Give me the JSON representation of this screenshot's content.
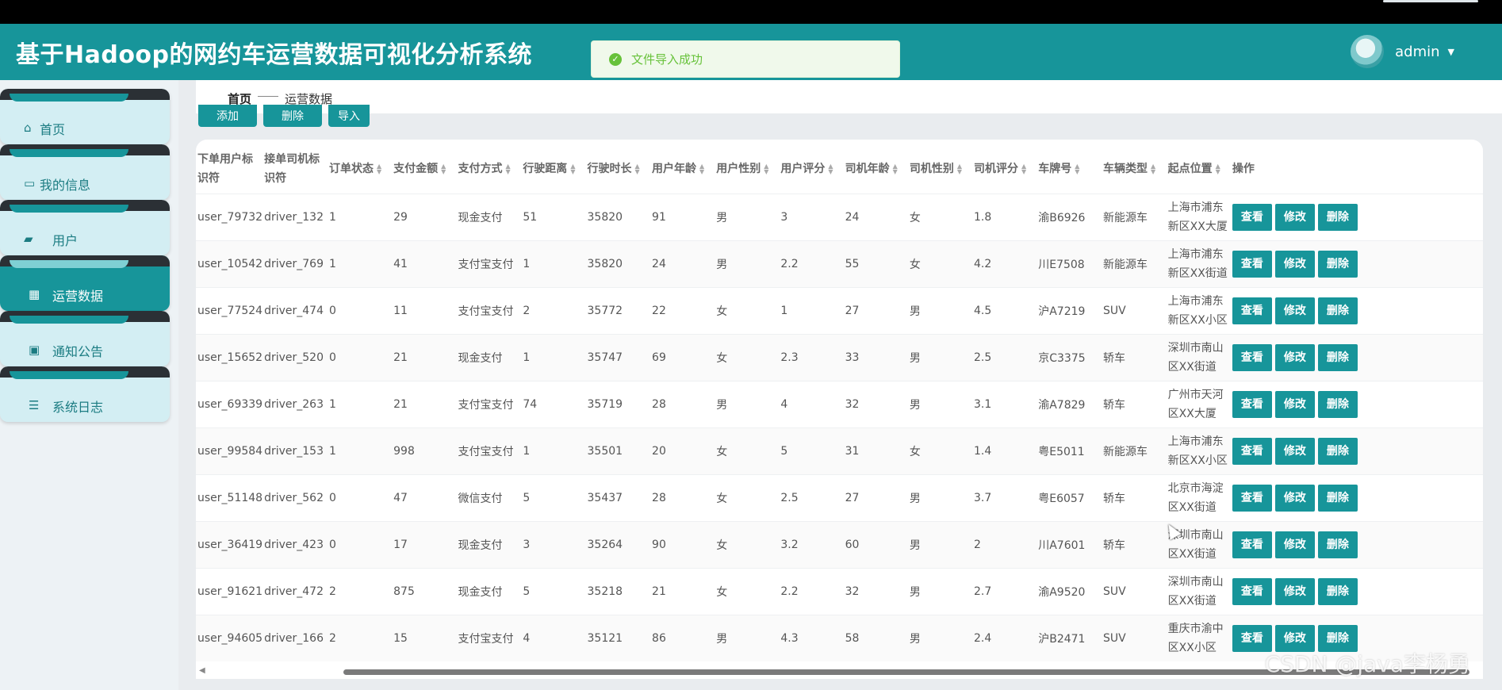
{
  "app": {
    "title": "基于Hadoop的网约车运营数据可视化分析系统"
  },
  "toast": {
    "message": "文件导入成功",
    "icon": "check-circle-icon",
    "color": "#67c23a"
  },
  "user": {
    "name": "admin"
  },
  "colors": {
    "brand": "#17959a",
    "header": "#17959a"
  },
  "sidebar": {
    "items": [
      {
        "label": "首页",
        "icon": "home-icon",
        "glyph": "⌂",
        "active": false
      },
      {
        "label": "我的信息",
        "icon": "id-card-icon",
        "glyph": "▭",
        "active": false
      },
      {
        "label": "用户",
        "icon": "chat-icon",
        "glyph": "▰",
        "active": false
      },
      {
        "label": "运营数据",
        "icon": "grid-icon",
        "glyph": "▦",
        "active": true
      },
      {
        "label": "通知公告",
        "icon": "clipboard-icon",
        "glyph": "▣",
        "active": false
      },
      {
        "label": "系统日志",
        "icon": "list-icon",
        "glyph": "☰",
        "active": false
      }
    ]
  },
  "breadcrumb": {
    "home": "首页",
    "current": "运营数据"
  },
  "toolbar": {
    "add_label": "添加",
    "delete_label": "删除",
    "import_label": "导入"
  },
  "table": {
    "columns": [
      "下单用户标识符",
      "接单司机标识符",
      "订单状态",
      "支付金额",
      "支付方式",
      "行驶距离",
      "行驶时长",
      "用户年龄",
      "用户性别",
      "用户评分",
      "司机年龄",
      "司机性别",
      "司机评分",
      "车牌号",
      "车辆类型",
      "起点位置",
      "操作"
    ],
    "rows": [
      [
        "user_79732",
        "driver_132",
        "1",
        "29",
        "现金支付",
        "51",
        "35820",
        "91",
        "男",
        "3",
        "24",
        "女",
        "1.8",
        "渝B6926",
        "新能源车",
        "上海市浦东新区XX大厦"
      ],
      [
        "user_10542",
        "driver_769",
        "1",
        "41",
        "支付宝支付",
        "1",
        "35820",
        "24",
        "男",
        "2.2",
        "55",
        "女",
        "4.2",
        "川E7508",
        "新能源车",
        "上海市浦东新区XX街道"
      ],
      [
        "user_77524",
        "driver_474",
        "0",
        "11",
        "支付宝支付",
        "2",
        "35772",
        "22",
        "女",
        "1",
        "27",
        "男",
        "4.5",
        "沪A7219",
        "SUV",
        "上海市浦东新区XX小区"
      ],
      [
        "user_15652",
        "driver_520",
        "0",
        "21",
        "现金支付",
        "1",
        "35747",
        "69",
        "女",
        "2.3",
        "33",
        "男",
        "2.5",
        "京C3375",
        "轿车",
        "深圳市南山区XX街道"
      ],
      [
        "user_69339",
        "driver_263",
        "1",
        "21",
        "支付宝支付",
        "74",
        "35719",
        "28",
        "男",
        "4",
        "32",
        "男",
        "3.1",
        "渝A7829",
        "轿车",
        "广州市天河区XX大厦"
      ],
      [
        "user_99584",
        "driver_153",
        "1",
        "998",
        "支付宝支付",
        "1",
        "35501",
        "20",
        "女",
        "5",
        "31",
        "女",
        "1.4",
        "粤E5011",
        "新能源车",
        "上海市浦东新区XX小区"
      ],
      [
        "user_51148",
        "driver_562",
        "0",
        "47",
        "微信支付",
        "5",
        "35437",
        "28",
        "女",
        "2.5",
        "27",
        "男",
        "3.7",
        "粤E6057",
        "轿车",
        "北京市海淀区XX街道"
      ],
      [
        "user_36419",
        "driver_423",
        "0",
        "17",
        "现金支付",
        "3",
        "35264",
        "90",
        "女",
        "3.2",
        "60",
        "男",
        "2",
        "川A7601",
        "轿车",
        "深圳市南山区XX街道"
      ],
      [
        "user_91621",
        "driver_472",
        "2",
        "875",
        "现金支付",
        "5",
        "35218",
        "21",
        "女",
        "2.2",
        "32",
        "男",
        "2.7",
        "渝A9520",
        "SUV",
        "深圳市南山区XX街道"
      ],
      [
        "user_94605",
        "driver_166",
        "2",
        "15",
        "支付宝支付",
        "4",
        "35121",
        "86",
        "男",
        "4.3",
        "58",
        "男",
        "2.4",
        "沪B2471",
        "SUV",
        "重庆市渝中区XX小区"
      ]
    ],
    "row_actions": {
      "view": "查看",
      "edit": "修改",
      "delete": "删除"
    }
  },
  "watermark": "CSDN @java李杨勇"
}
